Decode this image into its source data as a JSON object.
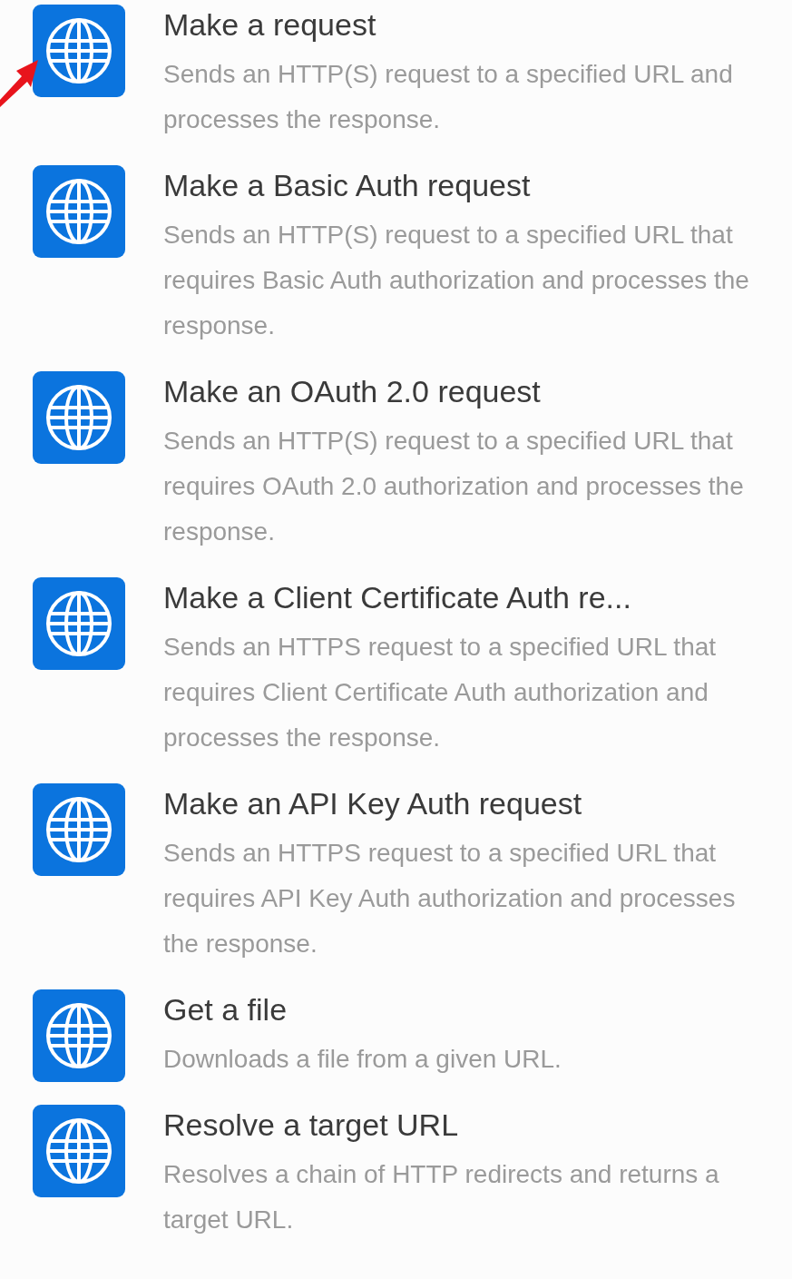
{
  "modules": [
    {
      "title": "Make a request",
      "description": "Sends an HTTP(S) request to a specified URL and processes the response."
    },
    {
      "title": "Make a Basic Auth request",
      "description": "Sends an HTTP(S) request to a specified URL that requires Basic Auth authorization and processes the response."
    },
    {
      "title": "Make an OAuth 2.0 request",
      "description": "Sends an HTTP(S) request to a specified URL that requires OAuth 2.0 authorization and processes the response."
    },
    {
      "title": "Make a Client Certificate Auth re...",
      "description": "Sends an HTTPS request to a specified URL that requires Client Certificate Auth authorization and processes the response."
    },
    {
      "title": "Make an API Key Auth request",
      "description": "Sends an HTTPS request to a specified URL that requires API Key Auth authorization and processes the response."
    },
    {
      "title": "Get a file",
      "description": "Downloads a file from a given URL."
    },
    {
      "title": "Resolve a target URL",
      "description": "Resolves a chain of HTTP redirects and returns a target URL."
    }
  ]
}
